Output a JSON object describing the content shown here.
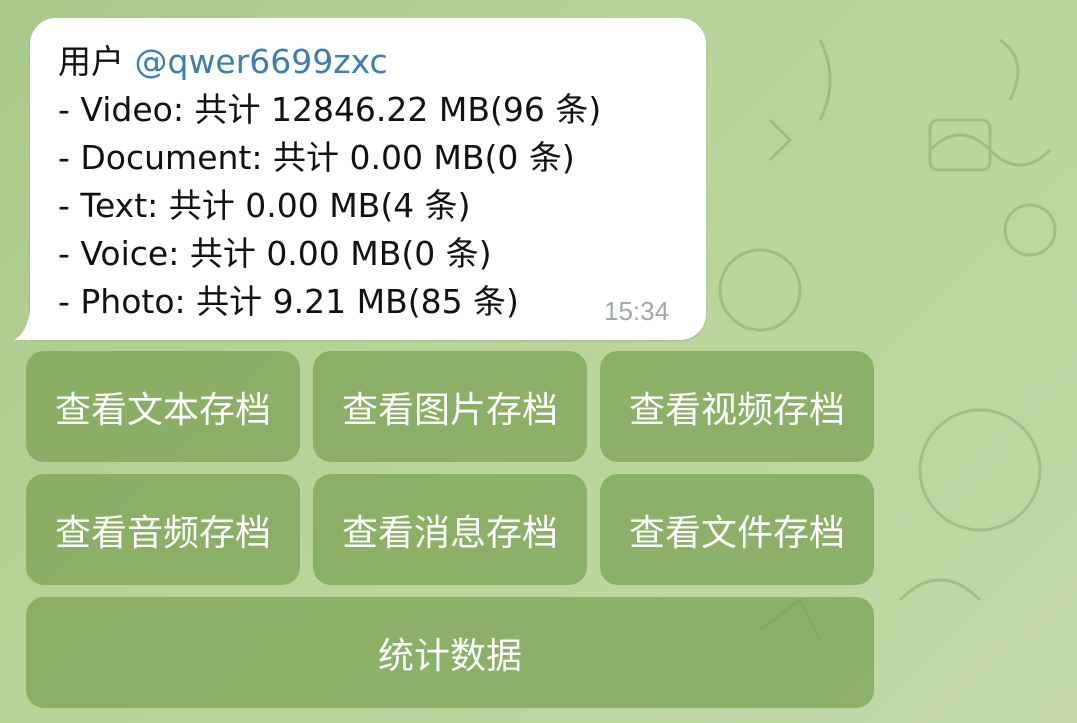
{
  "message": {
    "user_prefix": "用户 ",
    "user_handle": "@qwer6699zxc",
    "lines": [
      "- Video: 共计 12846.22 MB(96 条)",
      "- Document: 共计 0.00 MB(0 条)",
      "- Text: 共计 0.00 MB(4 条)",
      "- Voice: 共计 0.00 MB(0 条)",
      "- Photo: 共计 9.21 MB(85 条)"
    ],
    "time": "15:34"
  },
  "keyboard": {
    "row1": [
      "查看文本存档",
      "查看图片存档",
      "查看视频存档"
    ],
    "row2": [
      "查看音频存档",
      "查看消息存档",
      "查看文件存档"
    ],
    "row3": [
      "统计数据"
    ]
  },
  "colors": {
    "mention": "#3b7db5",
    "button_bg": "#7aa251",
    "wallpaper": "#b5d296"
  }
}
